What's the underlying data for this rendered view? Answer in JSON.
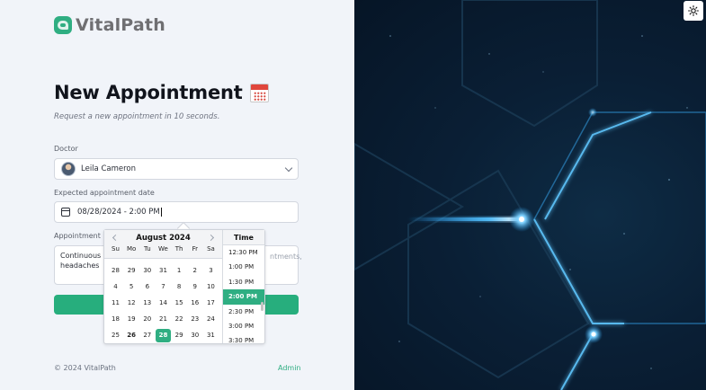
{
  "brand": {
    "name": "VitalPath"
  },
  "form": {
    "title": "New Appointment",
    "subtitle": "Request a new appointment in 10 seconds.",
    "doctor_label": "Doctor",
    "doctor_value": "Leila Cameron",
    "date_label": "Expected appointment date",
    "date_value": "08/28/2024 - 2:00 PM",
    "reason_label": "Appointment re",
    "reason_value_line1": "Continuous m",
    "reason_value_line2": "headaches",
    "reason_right_text": "ntments,"
  },
  "datepicker": {
    "month": "August 2024",
    "weekdays": [
      "Su",
      "Mo",
      "Tu",
      "We",
      "Th",
      "Fr",
      "Sa"
    ],
    "weeks": [
      [
        "28",
        "29",
        "30",
        "31",
        "1",
        "2",
        "3"
      ],
      [
        "4",
        "5",
        "6",
        "7",
        "8",
        "9",
        "10"
      ],
      [
        "11",
        "12",
        "13",
        "14",
        "15",
        "16",
        "17"
      ],
      [
        "18",
        "19",
        "20",
        "21",
        "22",
        "23",
        "24"
      ],
      [
        "25",
        "26",
        "27",
        "28",
        "29",
        "30",
        "31"
      ]
    ],
    "selected_day": "28",
    "today_day": "26",
    "time_header": "Time",
    "times": [
      "12:30 PM",
      "1:00 PM",
      "1:30 PM",
      "2:00 PM",
      "2:30 PM",
      "3:00 PM",
      "3:30 PM"
    ],
    "selected_time": "2:00 PM"
  },
  "footer": {
    "copyright": "© 2024 VitalPath",
    "admin_link": "Admin"
  },
  "icons": {
    "logo": "vitalpath-logo-icon",
    "calendar_emoji": "calendar-emoji-icon",
    "theme_toggle": "sun-icon"
  },
  "colors": {
    "accent": "#27ae7d",
    "background_left": "#f1f4f9",
    "background_right": "#0a1f35"
  }
}
